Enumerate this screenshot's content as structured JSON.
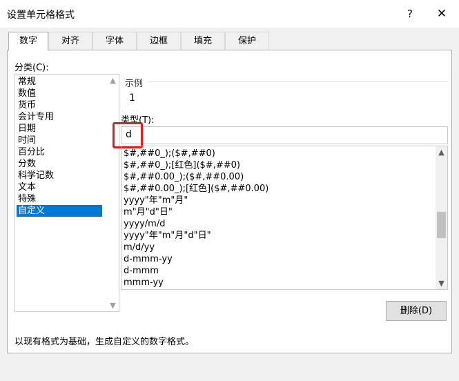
{
  "window": {
    "title": "设置单元格格式",
    "help": "?",
    "close": "✕"
  },
  "tabs": [
    {
      "label": "数字",
      "active": true
    },
    {
      "label": "对齐"
    },
    {
      "label": "字体"
    },
    {
      "label": "边框"
    },
    {
      "label": "填充"
    },
    {
      "label": "保护"
    }
  ],
  "category": {
    "label": "分类(C):",
    "items": [
      "常规",
      "数值",
      "货币",
      "会计专用",
      "日期",
      "时间",
      "百分比",
      "分数",
      "科学记数",
      "文本",
      "特殊",
      "自定义"
    ],
    "selected": "自定义"
  },
  "sample": {
    "legend": "示例",
    "value": "1"
  },
  "type": {
    "label": "类型(T):",
    "value": "d",
    "formats": [
      "$#,##0_);($#,##0)",
      "$#,##0_);[红色]($#,##0)",
      "$#,##0.00_);($#,##0.00)",
      "$#,##0.00_);[红色]($#,##0.00)",
      "yyyy\"年\"m\"月\"",
      "m\"月\"d\"日\"",
      "yyyy/m/d",
      "yyyy\"年\"m\"月\"d\"日\"",
      "m/d/yy",
      "d-mmm-yy",
      "d-mmm",
      "mmm-yy"
    ]
  },
  "buttons": {
    "delete": "删除(D)"
  },
  "description": "以现有格式为基础，生成自定义的数字格式。",
  "colors": {
    "selection": "#0078d7",
    "highlight_box": "#e02020"
  }
}
